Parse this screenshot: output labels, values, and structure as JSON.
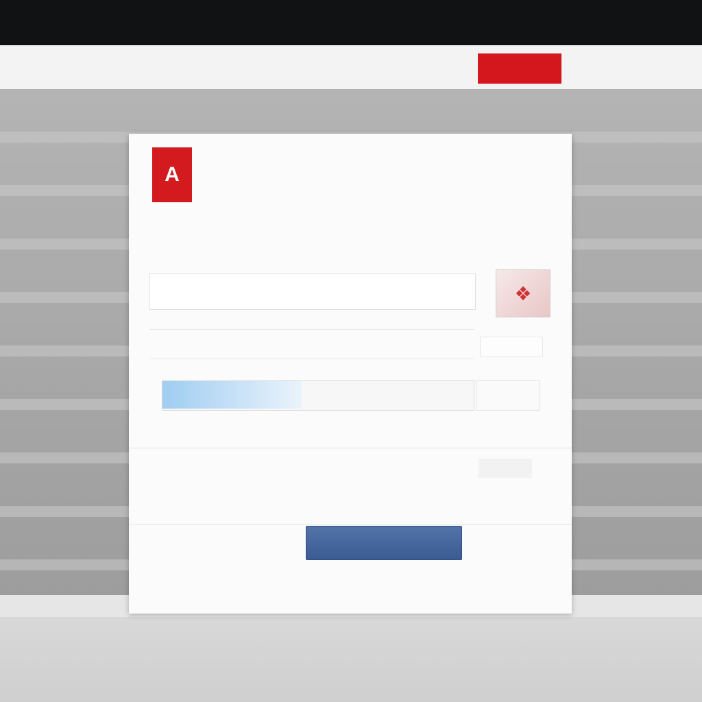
{
  "header": {
    "left_text": "",
    "red_button_label": "",
    "right_link": ""
  },
  "dialog": {
    "logo_glyph": "A",
    "title": "",
    "section_label": "",
    "info_line": "",
    "info_value": "",
    "info_sub": "",
    "row_a": {
      "small_label": "",
      "first": "",
      "second": ""
    },
    "thumbnail_icon": "document-icon",
    "row_b": {
      "small_label": "",
      "first": "",
      "second": "",
      "third": "",
      "note": ""
    },
    "progress": {
      "fraction": 0.45,
      "text": ""
    },
    "option": {
      "first": "",
      "second": "",
      "value": ""
    },
    "option_note": "",
    "primary_button_label": "",
    "secondary_link": ""
  },
  "colors": {
    "brand_red": "#d21a1f",
    "primary_blue": "#3a5b93",
    "progress_blue": "#9fcdf1"
  }
}
